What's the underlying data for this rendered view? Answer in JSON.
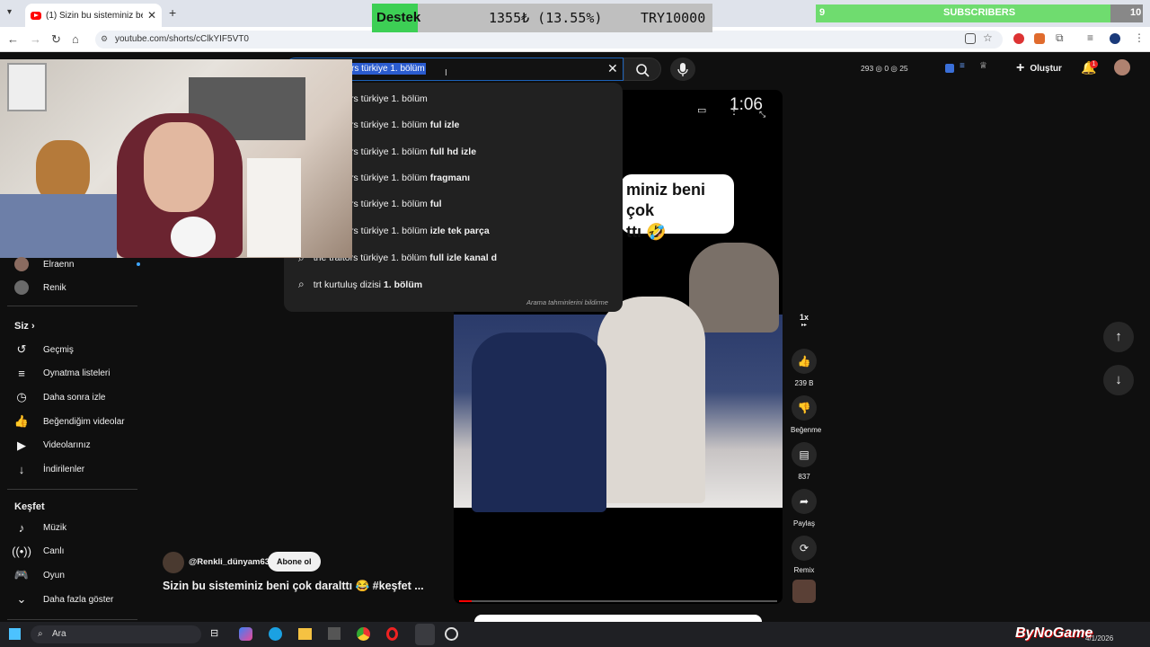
{
  "browser": {
    "tab_title": "(1) Sizin bu sisteminiz beni",
    "new_tab": "+",
    "url": "youtube.com/shorts/cClkYIF5VT0"
  },
  "overlays": {
    "goal_label": "Destek",
    "goal_amount": "1355₺ (13.55%)",
    "goal_target": "TRY10000",
    "goal_fraction": 0.1355,
    "sub_count": "9",
    "sub_label": "SUBSCRIBERS",
    "sub_target": "10",
    "sub_fraction": 0.9
  },
  "search": {
    "query": "rs türkiye 1. bölüm",
    "suggestions": [
      {
        "prefix": "rs türkiye 1. bölüm",
        "suffix": ""
      },
      {
        "prefix": "rs türkiye 1. bölüm ",
        "suffix": "ful izle"
      },
      {
        "prefix": "rs türkiye 1. bölüm ",
        "suffix": "full hd izle"
      },
      {
        "prefix": "rs türkiye 1. bölüm ",
        "suffix": "fragmanı"
      },
      {
        "prefix": "rs türkiye 1. bölüm ",
        "suffix": "ful"
      },
      {
        "prefix": "rs türkiye 1. bölüm ",
        "suffix": "izle tek parça"
      },
      {
        "prefix": "the traitors türkiye 1. bölüm ",
        "suffix": "full izle kanal d"
      },
      {
        "prefix": "trt kurtuluş dizisi ",
        "suffix": "1. bölüm"
      }
    ],
    "report": "Arama tahminlerini bildirme"
  },
  "header": {
    "stats": "293 ◎ 0 ◎ 25",
    "create": "Oluştur",
    "notif_count": "1"
  },
  "sidebar": {
    "subs": [
      {
        "label": "Elraenn"
      },
      {
        "label": "Renik"
      }
    ],
    "you_head": "Siz",
    "you_items": [
      {
        "label": "Geçmiş",
        "icon": "↺"
      },
      {
        "label": "Oynatma listeleri",
        "icon": "≡"
      },
      {
        "label": "Daha sonra izle",
        "icon": "◷"
      },
      {
        "label": "Beğendiğim videolar",
        "icon": "👍"
      },
      {
        "label": "Videolarınız",
        "icon": "▶"
      },
      {
        "label": "İndirilenler",
        "icon": "↓"
      }
    ],
    "explore_head": "Keşfet",
    "explore_items": [
      {
        "label": "Müzik",
        "icon": "♪"
      },
      {
        "label": "Canlı",
        "icon": "((•))"
      },
      {
        "label": "Oyun",
        "icon": "🎮"
      },
      {
        "label": "Daha fazla göster",
        "icon": "⌄"
      }
    ]
  },
  "video": {
    "time": "1:06",
    "caption_line1": "miniz beni çok",
    "caption_line2": "ttı 🤣",
    "channel": "@Renkli_dünyam63",
    "subscribe": "Abone ol",
    "title": "Sizin bu sisteminiz beni çok daralttı 😂 #keşfet ..."
  },
  "rail": {
    "speed": "1x",
    "likes": "239 B",
    "dislike": "Beğenme",
    "comments": "837",
    "share": "Paylaş",
    "remix": "Remix"
  },
  "taskbar": {
    "search": "Ara",
    "date": "4/1/2026",
    "watermark": "ByNoGame"
  }
}
